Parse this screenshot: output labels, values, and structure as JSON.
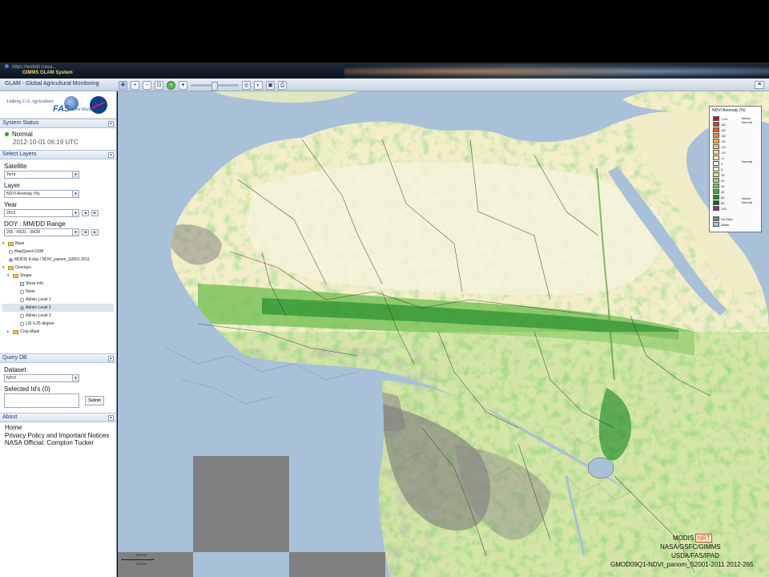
{
  "browser": {
    "url": "https://webdir.nasa...",
    "tab_title": "GIMMS GLAM System"
  },
  "app": {
    "title": "GLAM - Global Agricultural Monitoring",
    "subtitle": "BETA"
  },
  "logo": {
    "tagline": "Linking U.S. Agriculture",
    "fas": "FAS",
    "world": "to the World",
    "nasa": "NASA"
  },
  "system_status": {
    "heading": "System Status",
    "status": "Normal",
    "timestamp": "2012-10-01 06:19 UTC"
  },
  "select_layers": {
    "heading": "Select Layers",
    "satellite_label": "Satellite",
    "satellite_value": "Terra",
    "layer_label": "Layer",
    "layer_value": "NDVI Anomaly (%)",
    "year_label": "Year",
    "year_value": "2012",
    "doy_label": "DOY : MM/DD Range",
    "doy_value": "265 : 09/21 - 09/28"
  },
  "layer_tree": {
    "base": "Base",
    "mapquest": "MapQuest-OSM",
    "modis": "MODIS 8-day / NDVI_panom_S2001-2011",
    "overlays": "Overlays",
    "shape": "Shape",
    "show_info": "Show Info",
    "none": "None",
    "admin1": "Admin Level 1",
    "admin2": "Admin Level 2",
    "admin3": "Admin Level 3",
    "lis": "LIS 0.25 degree",
    "crop_mask": "Crop Mask"
  },
  "query_db": {
    "heading": "Query DB",
    "dataset_label": "Dataset",
    "dataset_value": "NDVI",
    "selected_label": "Selected Id's (0)",
    "selected_placeholder": "...",
    "submit": "Submit"
  },
  "about": {
    "heading": "About",
    "home": "Home",
    "privacy": "Privacy Policy and Important Notices",
    "official": "NASA Official: Compton Tucker"
  },
  "legend": {
    "title": "NDVI Anomaly (%)",
    "items": [
      {
        "label": "-125",
        "color": "#c8102e"
      },
      {
        "label": "-80",
        "color": "#d93a2a"
      },
      {
        "label": "-60",
        "color": "#e25a2a"
      },
      {
        "label": "-40",
        "color": "#ec8a3a"
      },
      {
        "label": "-30",
        "color": "#f0a64a"
      },
      {
        "label": "-20",
        "color": "#f4c063"
      },
      {
        "label": "-10",
        "color": "#f7d98a"
      },
      {
        "label": "-5",
        "color": "#faeab2"
      },
      {
        "label": "0",
        "color": "#fbf6dc"
      },
      {
        "label": "5",
        "color": "#e4f3c4"
      },
      {
        "label": "10",
        "color": "#c4e89a"
      },
      {
        "label": "20",
        "color": "#9fd873"
      },
      {
        "label": "30",
        "color": "#73c450"
      },
      {
        "label": "40",
        "color": "#3fa83a"
      },
      {
        "label": "60",
        "color": "#1f8a2a"
      },
      {
        "label": "80",
        "color": "#0e6b1f"
      },
      {
        "label": "125",
        "color": "#8a2a8a"
      },
      {
        "label": "No Data",
        "color": "#808080"
      },
      {
        "label": "Water",
        "color": "#a8c0d8"
      }
    ],
    "below_normal": "Below Normal",
    "normal": "Normal",
    "above_normal": "Above Normal"
  },
  "credits": {
    "modis": "MODIS",
    "nrt": "NRT",
    "line2": "NASA/GSFC/GIMMS",
    "line3": "USDA/FAS/IPAD",
    "line4": "GMOD09Q1-NDVI_panom_S2001-2011 2012-265"
  },
  "scale": {
    "km": "500 km",
    "mi": "200 mi"
  },
  "colors": {
    "water": "#a8c0d8",
    "land": "#f3eec9",
    "green_belt": "#2e9a2e",
    "no_data": "#808080"
  }
}
